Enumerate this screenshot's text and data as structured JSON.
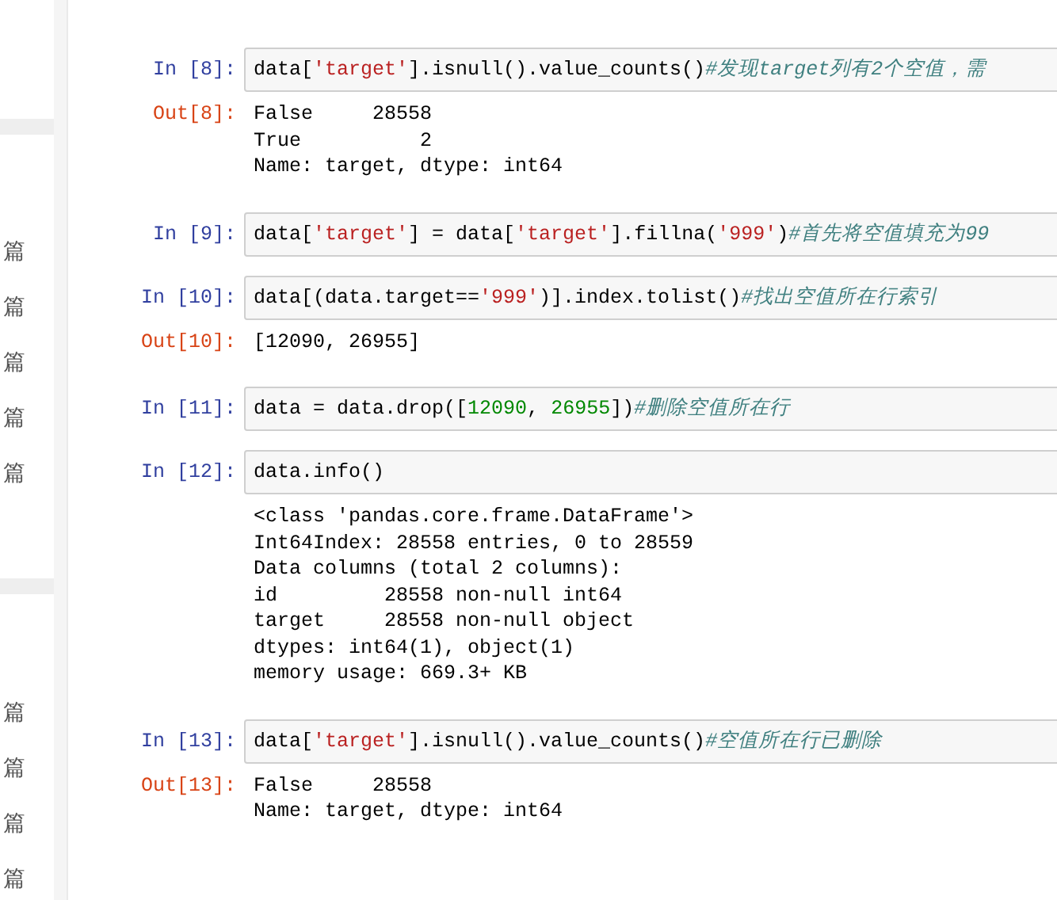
{
  "sidebar": {
    "groups": [
      {
        "items": [
          "篇",
          "篇",
          "篇",
          "篇",
          "篇"
        ]
      },
      {
        "items": [
          "篇",
          "篇",
          "篇",
          "篇"
        ]
      }
    ]
  },
  "cells": [
    {
      "kind": "input",
      "prompt": "In [8]:",
      "code": [
        {
          "kind": "plain",
          "t": "data["
        },
        {
          "kind": "string",
          "t": "'target'"
        },
        {
          "kind": "plain",
          "t": "].isnull().value_counts()"
        },
        {
          "kind": "comment",
          "t": "#发现target列有2个空值，需"
        }
      ]
    },
    {
      "kind": "output",
      "prompt": "Out[8]:",
      "lines": [
        "False     28558",
        "True          2",
        "Name: target, dtype: int64"
      ]
    },
    {
      "kind": "input",
      "prompt": "In [9]:",
      "code": [
        {
          "kind": "plain",
          "t": "data["
        },
        {
          "kind": "string",
          "t": "'target'"
        },
        {
          "kind": "plain",
          "t": "] = data["
        },
        {
          "kind": "string",
          "t": "'target'"
        },
        {
          "kind": "plain",
          "t": "].fillna("
        },
        {
          "kind": "string",
          "t": "'999'"
        },
        {
          "kind": "plain",
          "t": ")"
        },
        {
          "kind": "comment",
          "t": "#首先将空值填充为99"
        }
      ]
    },
    {
      "kind": "input",
      "prompt": "In [10]:",
      "code": [
        {
          "kind": "plain",
          "t": "data[(data.target=="
        },
        {
          "kind": "string",
          "t": "'999'"
        },
        {
          "kind": "plain",
          "t": ")].index.tolist()"
        },
        {
          "kind": "comment",
          "t": "#找出空值所在行索引"
        }
      ]
    },
    {
      "kind": "output",
      "prompt": "Out[10]:",
      "lines": [
        "[12090, 26955]"
      ]
    },
    {
      "kind": "input",
      "prompt": "In [11]:",
      "code": [
        {
          "kind": "plain",
          "t": "data = data.drop(["
        },
        {
          "kind": "number",
          "t": "12090"
        },
        {
          "kind": "plain",
          "t": ", "
        },
        {
          "kind": "number",
          "t": "26955"
        },
        {
          "kind": "plain",
          "t": "])"
        },
        {
          "kind": "comment",
          "t": "#删除空值所在行"
        }
      ]
    },
    {
      "kind": "input",
      "prompt": "In [12]:",
      "code": [
        {
          "kind": "plain",
          "t": "data.info()"
        }
      ]
    },
    {
      "kind": "output",
      "lines": [
        "<class 'pandas.core.frame.DataFrame'>",
        "Int64Index: 28558 entries, 0 to 28559",
        "Data columns (total 2 columns):",
        "id         28558 non-null int64",
        "target     28558 non-null object",
        "dtypes: int64(1), object(1)",
        "memory usage: 669.3+ KB"
      ]
    },
    {
      "kind": "input",
      "prompt": "In [13]:",
      "code": [
        {
          "kind": "plain",
          "t": "data["
        },
        {
          "kind": "string",
          "t": "'target'"
        },
        {
          "kind": "plain",
          "t": "].isnull().value_counts()"
        },
        {
          "kind": "comment",
          "t": "#空值所在行已删除"
        }
      ]
    },
    {
      "kind": "output",
      "prompt": "Out[13]:",
      "lines": [
        "False     28558",
        "Name: target, dtype: int64"
      ]
    }
  ]
}
